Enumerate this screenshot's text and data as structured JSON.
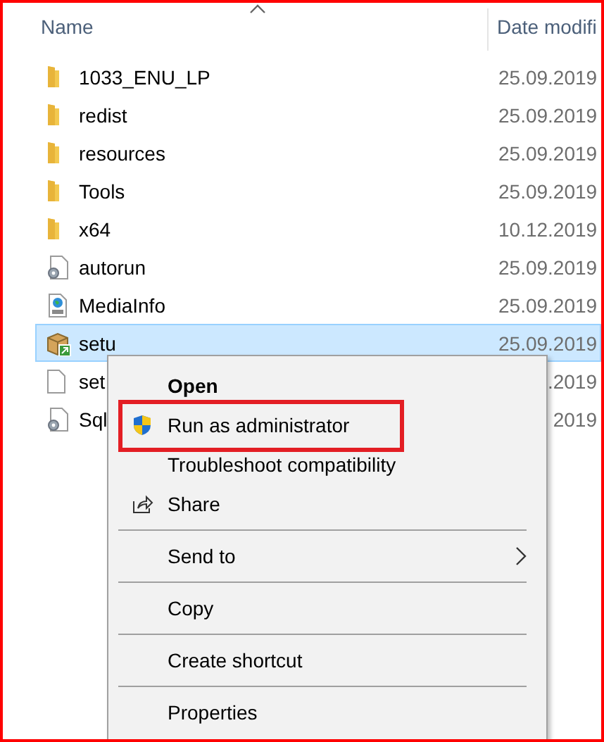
{
  "header": {
    "name_column": "Name",
    "date_column": "Date modifi"
  },
  "files": [
    {
      "kind": "folder",
      "name": "1033_ENU_LP",
      "date": "25.09.2019",
      "selected": false
    },
    {
      "kind": "folder",
      "name": "redist",
      "date": "25.09.2019",
      "selected": false
    },
    {
      "kind": "folder",
      "name": "resources",
      "date": "25.09.2019",
      "selected": false
    },
    {
      "kind": "folder",
      "name": "Tools",
      "date": "25.09.2019",
      "selected": false
    },
    {
      "kind": "folder",
      "name": "x64",
      "date": "10.12.2019",
      "selected": false
    },
    {
      "kind": "settings",
      "name": "autorun",
      "date": "25.09.2019",
      "selected": false
    },
    {
      "kind": "web",
      "name": "MediaInfo",
      "date": "25.09.2019",
      "selected": false
    },
    {
      "kind": "installer",
      "name": "setu",
      "date": "25.09.2019",
      "selected": true
    },
    {
      "kind": "blank",
      "name": "set",
      "date": ".2019",
      "selected": false
    },
    {
      "kind": "settings",
      "name": "Sql",
      "date": "2019",
      "selected": false
    }
  ],
  "menu": {
    "items": [
      {
        "kind": "default",
        "label": "Open",
        "highlighted": false
      },
      {
        "kind": "shield",
        "label": "Run as administrator",
        "highlighted": true
      },
      {
        "kind": "plain",
        "label": "Troubleshoot compatibility",
        "highlighted": false
      },
      {
        "kind": "share",
        "label": "Share",
        "highlighted": false
      },
      {
        "kind": "separator"
      },
      {
        "kind": "submenu",
        "label": "Send to",
        "highlighted": false
      },
      {
        "kind": "separator"
      },
      {
        "kind": "plain",
        "label": "Copy",
        "highlighted": false
      },
      {
        "kind": "separator"
      },
      {
        "kind": "plain",
        "label": "Create shortcut",
        "highlighted": false
      },
      {
        "kind": "separator"
      },
      {
        "kind": "plain",
        "label": "Properties",
        "highlighted": false
      }
    ]
  }
}
